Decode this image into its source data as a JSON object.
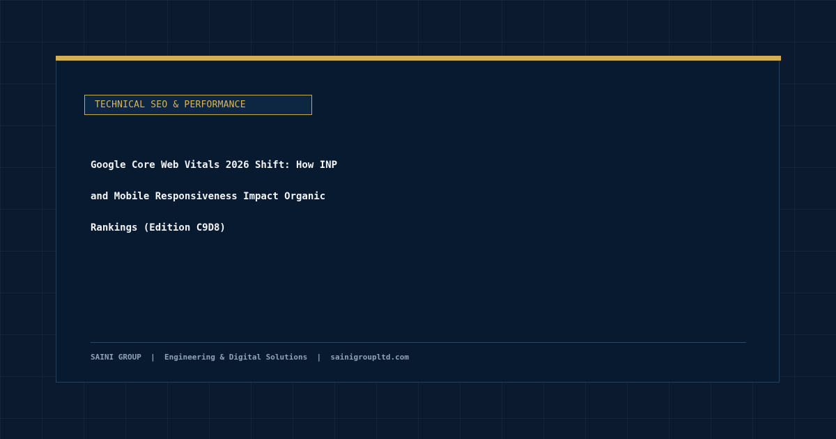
{
  "badge": {
    "label": "TECHNICAL SEO & PERFORMANCE"
  },
  "title": {
    "line1": "Google Core Web Vitals 2026 Shift: How INP",
    "line2": "and Mobile Responsiveness Impact Organic",
    "line3": "Rankings (Edition C9D8)"
  },
  "footer": {
    "brand": "SAINI GROUP",
    "separator": "|",
    "tagline": "Engineering & Digital Solutions",
    "website": "sainigroupltd.com"
  },
  "colors": {
    "background": "#0b1a2e",
    "card": "#081a2f",
    "accent": "#d4af4f",
    "badge_text": "#d8b65c",
    "title_text": "#f2f4f7",
    "footer_text": "#8ea3bb"
  }
}
